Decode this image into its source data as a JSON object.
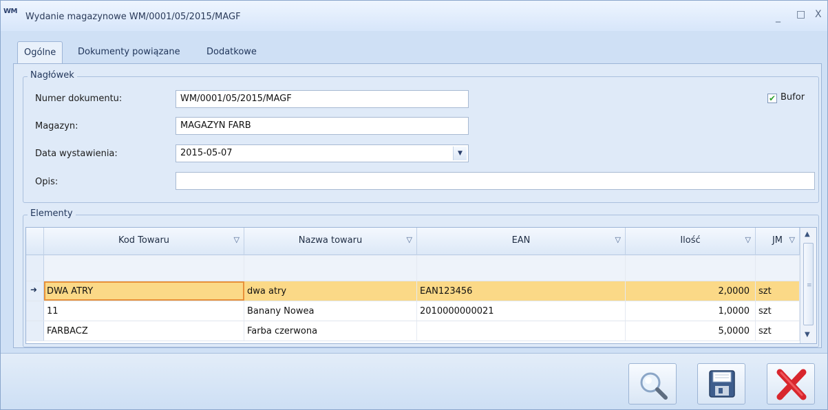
{
  "window": {
    "icon_text": "WM",
    "title": "Wydanie magazynowe WM/0001/05/2015/MAGF",
    "min": "_",
    "max": "□",
    "close": "X"
  },
  "tabs": [
    {
      "label": "Ogólne",
      "active": true
    },
    {
      "label": "Dokumenty powiązane",
      "active": false
    },
    {
      "label": "Dodatkowe",
      "active": false
    }
  ],
  "header_group": {
    "title": "Nagłówek",
    "numer_label": "Numer dokumentu:",
    "numer_value": "WM/0001/05/2015/MAGF",
    "magazyn_label": "Magazyn:",
    "magazyn_value": "MAGAZYN FARB",
    "data_label": "Data wystawienia:",
    "data_value": "2015-05-07",
    "opis_label": "Opis:",
    "opis_value": "",
    "bufor_label": "Bufor",
    "bufor_checked": true
  },
  "elements_group": {
    "title": "Elementy",
    "columns": [
      "Kod Towaru",
      "Nazwa towaru",
      "EAN",
      "Ilość",
      "JM"
    ],
    "rows": [
      {
        "kod": "DWA ATRY",
        "nazwa": "dwa atry",
        "ean": "EAN123456",
        "ilosc": "2,0000",
        "jm": "szt",
        "selected": true
      },
      {
        "kod": "11",
        "nazwa": "Banany Nowea",
        "ean": "2010000000021",
        "ilosc": "1,0000",
        "jm": "szt",
        "selected": false
      },
      {
        "kod": "FARBACZ",
        "nazwa": "Farba czerwona",
        "ean": "",
        "ilosc": "5,0000",
        "jm": "szt",
        "selected": false
      }
    ]
  },
  "toolbar": {
    "buttons": [
      "search-icon",
      "save-icon",
      "cancel-icon"
    ]
  },
  "colors": {
    "selected_row": "#fbd987",
    "focus_outline": "#e8913a",
    "close_red": "#d8262d"
  }
}
